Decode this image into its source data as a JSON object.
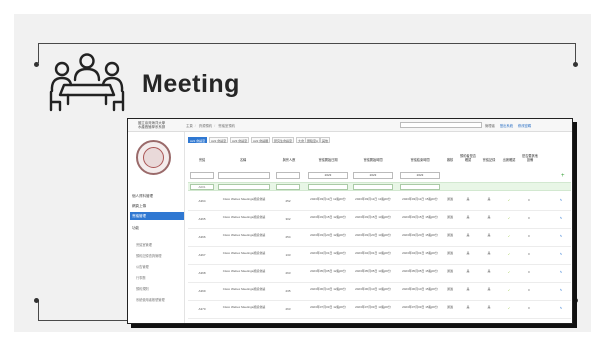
{
  "slide": {
    "title": "Meeting",
    "icon": "meeting-people-table-icon"
  },
  "app": {
    "system_title": "國立臺灣海洋大學\n水產養殖學系系辦",
    "breadcrumb": [
      "主頁",
      "資源預約",
      "會議室預約"
    ],
    "top_right": [
      "管理者",
      "登出系統",
      "修改密碼"
    ],
    "sidebar": {
      "items": [
        {
          "label": "個人資料管理",
          "active": false
        },
        {
          "label": "網頁上傳",
          "active": false
        },
        {
          "label": "會議管理",
          "active": true
        },
        {
          "label": "功能",
          "active": false
        }
      ],
      "sub_items": [
        "會議室管理",
        "預約記錄查詢管理",
        "公告管理",
        "行事曆",
        "預約規則",
        "系統使用者帳號管理"
      ]
    },
    "tabs": [
      "A21 會議室",
      "A22 會議室",
      "A23 會議室",
      "A22 會議廳",
      "研究生會議室",
      "大會",
      "實驗室A",
      "其他"
    ],
    "table": {
      "headers": [
        "會議",
        "名稱",
        "與會人數",
        "會議開始日期",
        "會議開始時間",
        "會議結束時間",
        "審核",
        "預約者是否確認",
        "會議記錄",
        "出席確認",
        "是否要其他設備",
        "操作"
      ],
      "filters": [
        "",
        "",
        "",
        "2023",
        "2023",
        "2023"
      ],
      "add_row_id": "A001",
      "rows": [
        {
          "id": "A364",
          "name": "Cisco Webex Meetings視訊會議",
          "count": "252",
          "start": "2023年03月11日 12點00分",
          "begin": "2023年03月11日 13點00分",
          "end": "2023年03月11日 15點00分",
          "status": "通過",
          "c1": "是",
          "c2": "是"
        },
        {
          "id": "A365",
          "name": "Cisco Webex Meetings視訊會議",
          "count": "302",
          "start": "2023年03月15日 12點00分",
          "begin": "2023年03月15日 13點00分",
          "end": "2023年03月15日 15點00分",
          "status": "通過",
          "c1": "是",
          "c2": "是"
        },
        {
          "id": "A366",
          "name": "Cisco Webex Meetings視訊會議",
          "count": "254",
          "start": "2023年03月20日 12點00分",
          "begin": "2023年03月20日 13點00分",
          "end": "2023年03月20日 15點00分",
          "status": "通過",
          "c1": "是",
          "c2": "是"
        },
        {
          "id": "A367",
          "name": "Cisco Webex Meetings視訊會議",
          "count": "133",
          "start": "2023年04月01日 12點00分",
          "begin": "2023年04月01日 13點00分",
          "end": "2023年04月01日 15點00分",
          "status": "通過",
          "c1": "是",
          "c2": "是"
        },
        {
          "id": "A368",
          "name": "Cisco Webex Meetings視訊會議",
          "count": "263",
          "start": "2023年05月05日 12點00分",
          "begin": "2023年05月05日 13點00分",
          "end": "2023年05月05日 15點00分",
          "status": "通過",
          "c1": "是",
          "c2": "是"
        },
        {
          "id": "A369",
          "name": "Cisco Webex Meetings視訊會議",
          "count": "235",
          "start": "2023年06月10日 12點00分",
          "begin": "2023年06月10日 13點00分",
          "end": "2023年06月10日 15點00分",
          "status": "通過",
          "c1": "是",
          "c2": "是"
        },
        {
          "id": "A370",
          "name": "Cisco Webex Meetings視訊會議",
          "count": "263",
          "start": "2023年07月03日 12點00分",
          "begin": "2023年07月03日 13點00分",
          "end": "2023年07月03日 15點00分",
          "status": "通過",
          "c1": "是",
          "c2": "是"
        }
      ]
    }
  },
  "colors": {
    "accent": "#2f78d2",
    "ok": "#8bbf2a",
    "add_row": "#e8f6e6"
  }
}
